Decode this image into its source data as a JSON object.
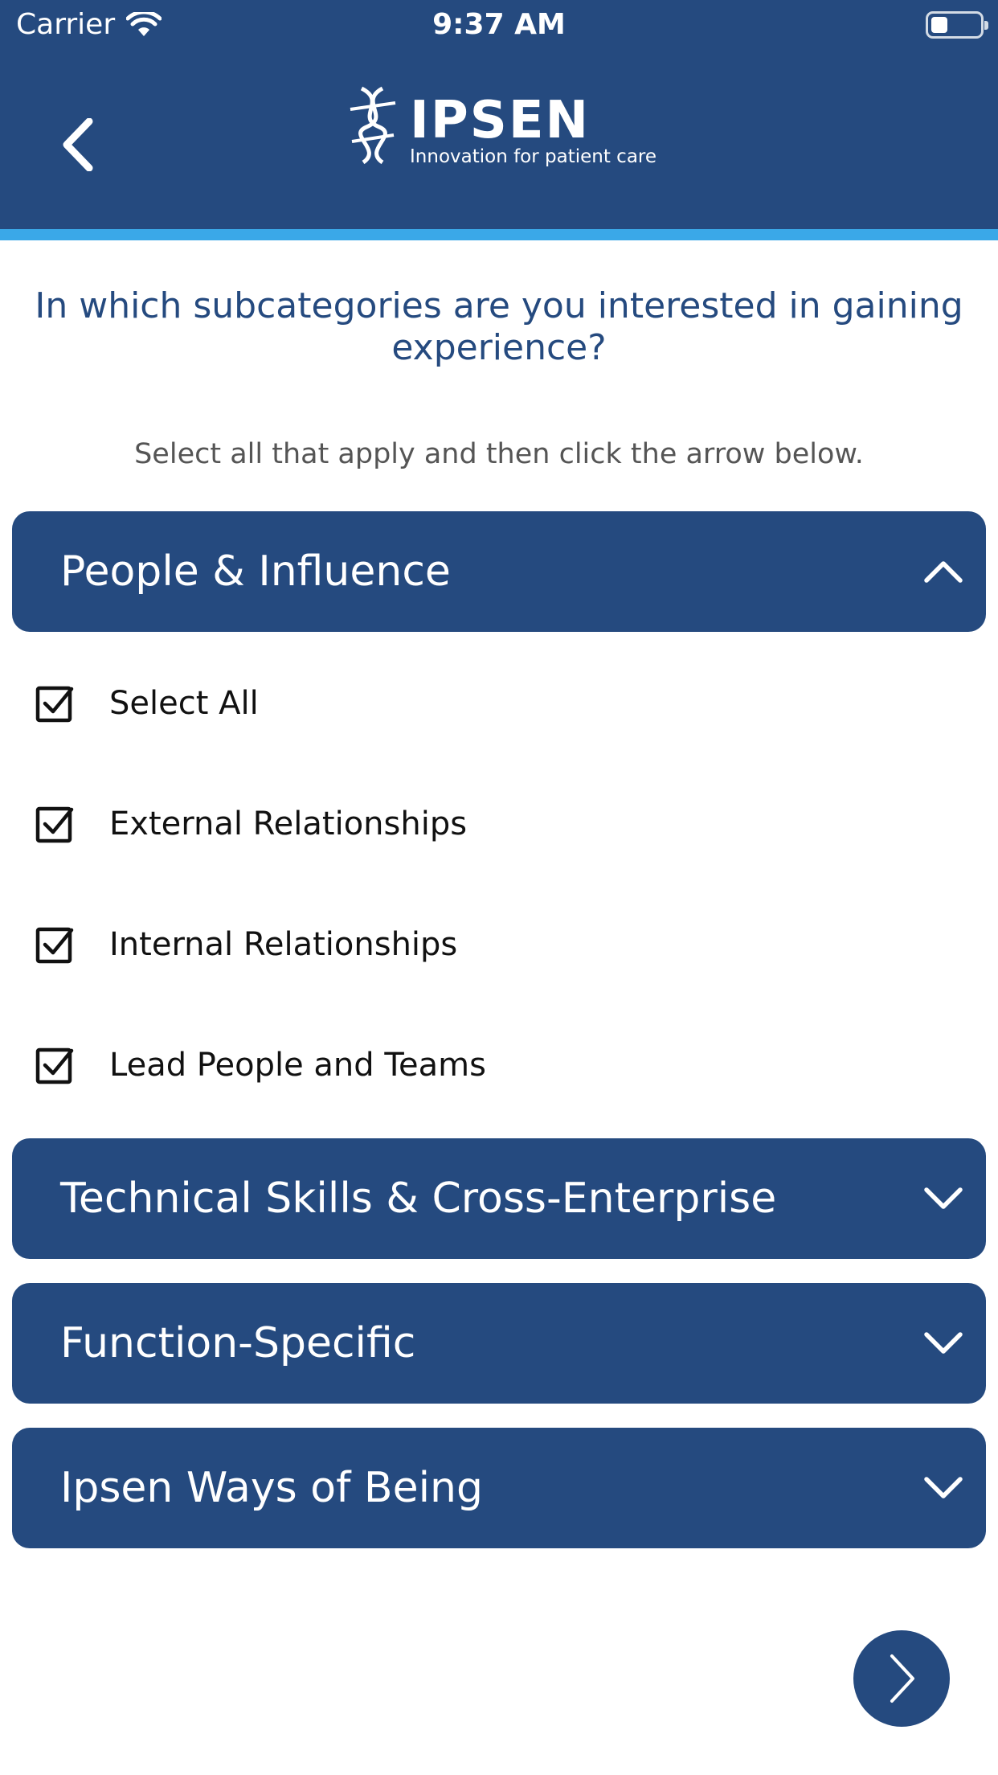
{
  "status_bar": {
    "carrier": "Carrier",
    "time": "9:37 AM"
  },
  "header": {
    "brand": "IPSEN",
    "tagline": "Innovation for patient care"
  },
  "question": "In which subcategories are you interested in gaining experience?",
  "instruction": "Select all that apply and then click the arrow below.",
  "sections": [
    {
      "title": "People & Influence",
      "expanded": true,
      "options": [
        {
          "label": "Select All",
          "checked": true
        },
        {
          "label": "External Relationships",
          "checked": true
        },
        {
          "label": "Internal Relationships",
          "checked": true
        },
        {
          "label": "Lead People and Teams",
          "checked": true
        }
      ]
    },
    {
      "title": "Technical Skills & Cross-Enterprise",
      "expanded": false
    },
    {
      "title": "Function-Specific",
      "expanded": false
    },
    {
      "title": "Ipsen Ways of Being",
      "expanded": false
    }
  ],
  "colors": {
    "primary": "#254a7f",
    "accent_stripe": "#3aa8e8",
    "question_text": "#254a7f"
  }
}
